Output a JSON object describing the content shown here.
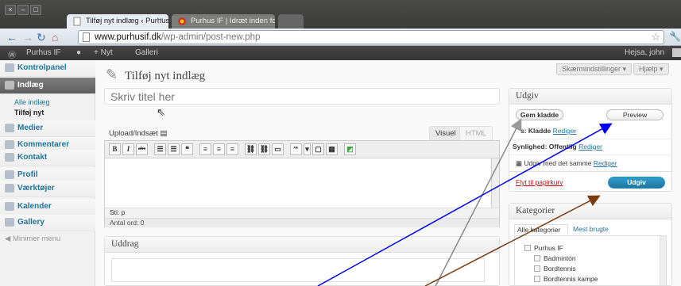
{
  "browser": {
    "window_buttons": [
      "×",
      "–",
      "□"
    ],
    "tabs": [
      {
        "title": "Tilføj nyt indlæg ‹ Purhus I",
        "close": "×"
      },
      {
        "title": "Purhus IF | Idræt inden for",
        "close": "×"
      },
      {
        "title": ""
      }
    ],
    "url": {
      "host": "www.purhusif.dk",
      "path": "/wp-admin/post-new.php"
    }
  },
  "adminbar": {
    "wp_logo": "Ⓦ",
    "site": "Purhus IF",
    "new": "+ Nyt",
    "gallery": "Galleri",
    "greeting": "Hejsa, john"
  },
  "sidebar": {
    "items": [
      {
        "label": "Kontrolpanel",
        "icon": "dashboard-icon"
      },
      {
        "label": "Indlæg",
        "icon": "pin-icon"
      },
      {
        "label": "Medier",
        "icon": "media-icon"
      },
      {
        "label": "Kommentarer",
        "icon": "comment-icon"
      },
      {
        "label": "Kontakt",
        "icon": "contact-icon"
      },
      {
        "label": "Profil",
        "icon": "profile-icon"
      },
      {
        "label": "Værktøjer",
        "icon": "tools-icon"
      },
      {
        "label": "Kalender",
        "icon": "calendar-icon"
      },
      {
        "label": "Gallery",
        "icon": "gallery-icon"
      }
    ],
    "sub_items": [
      "Alle indlæg",
      "Tilføj nyt"
    ],
    "minimize": "Minimer menu"
  },
  "page": {
    "title": "Tilføj nyt indlæg",
    "screen_options": "Skærmindstillinger ▾",
    "help": "Hjælp ▾",
    "title_placeholder": "Skriv titel her",
    "upload_label": "Upload/Indsæt",
    "tab_visual": "Visuel",
    "tab_html": "HTML",
    "toolbar_buttons": [
      "B",
      "I",
      "abc",
      "☰",
      "☰",
      "❝",
      "≡",
      "≡",
      "≡",
      "⛓",
      "⛓",
      "▭",
      "ᴬᴮᶜ",
      "▾",
      "▢",
      "▦",
      "◩"
    ],
    "path_label": "Sti: p",
    "word_count": "Antal ord: 0",
    "excerpt_title": "Uddrag"
  },
  "publish": {
    "title": "Udgiv",
    "save_draft": "Gem kladde",
    "preview": "Preview",
    "status_label": "s: Kladde",
    "status_edit": "Rediger",
    "visibility_label": "Synlighed: Offentlig",
    "visibility_edit": "Rediger",
    "publish_label": "Udgiv med det samme",
    "publish_edit": "Rediger",
    "trash": "Flyt til papirkurv",
    "publish_button": "Udgiv"
  },
  "categories": {
    "title": "Kategorier",
    "tab_all": "Alle kategorier",
    "tab_popular": "Mest brugte",
    "items": [
      "Purhus IF",
      "Badminton",
      "Bordtennis",
      "Bordtennis kampe"
    ]
  },
  "colors": {
    "arrow_gray": "#888888",
    "arrow_blue": "#0000ee",
    "arrow_brown": "#7a3b10",
    "publish_button": "#21759b",
    "trash_link": "#bc0b0b"
  }
}
